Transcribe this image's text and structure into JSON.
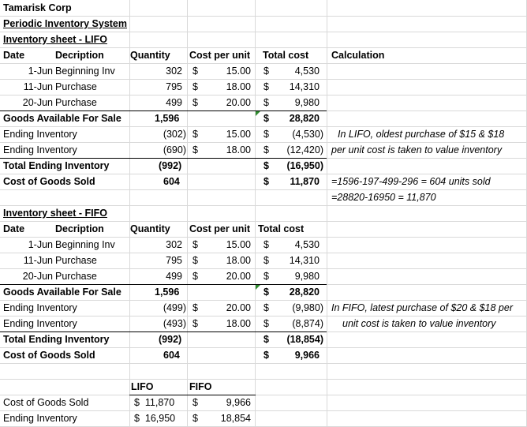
{
  "lifo": {
    "company": "Tamarisk Corp",
    "system": "Periodic Inventory System",
    "sheet_title": "Inventory sheet - LIFO",
    "headers": {
      "date": "Date",
      "desc": "Decription",
      "qty": "Quantity",
      "cpu": "Cost per unit",
      "total": "Total cost",
      "calc": "Calculation"
    },
    "rows": [
      {
        "date": "1-Jun",
        "desc": "Beginning Inv",
        "qty": "302",
        "cur1": "$",
        "cpu": "15.00",
        "cur2": "$",
        "total": "4,530"
      },
      {
        "date": "11-Jun",
        "desc": "Purchase",
        "qty": "795",
        "cur1": "$",
        "cpu": "18.00",
        "cur2": "$",
        "total": "14,310"
      },
      {
        "date": "20-Jun",
        "desc": "Purchase",
        "qty": "499",
        "cur1": "$",
        "cpu": "20.00",
        "cur2": "$",
        "total": "9,980"
      }
    ],
    "goods_available": {
      "label": "Goods Available For Sale",
      "qty": "1,596",
      "cur": "$",
      "total": "28,820"
    },
    "ending_rows": [
      {
        "label": "Ending Inventory",
        "qty": "(302)",
        "cur1": "$",
        "cpu": "15.00",
        "cur2": "$",
        "total": "(4,530)"
      },
      {
        "label": "Ending Inventory",
        "qty": "(690)",
        "cur1": "$",
        "cpu": "18.00",
        "cur2": "$",
        "total": "(12,420)"
      }
    ],
    "total_ending": {
      "label": "Total Ending Inventory",
      "qty": "(992)",
      "cur": "$",
      "total": "(16,950)"
    },
    "cogs": {
      "label": "Cost of Goods Sold",
      "qty": "604",
      "cur": "$",
      "total": "11,870"
    },
    "note_line1": "In LIFO, oldest purchase of $15 & $18",
    "note_line2": "per unit cost is taken to value inventory",
    "calc_line1": "=1596-197-499-296 = 604 units sold",
    "calc_line2": "=28820-16950 = 11,870"
  },
  "fifo": {
    "sheet_title": "Inventory sheet - FIFO",
    "headers": {
      "date": "Date",
      "desc": "Decription",
      "qty": "Quantity",
      "cpu": "Cost per unit",
      "total": "Total cost"
    },
    "rows": [
      {
        "date": "1-Jun",
        "desc": "Beginning Inv",
        "qty": "302",
        "cur1": "$",
        "cpu": "15.00",
        "cur2": "$",
        "total": "4,530"
      },
      {
        "date": "11-Jun",
        "desc": "Purchase",
        "qty": "795",
        "cur1": "$",
        "cpu": "18.00",
        "cur2": "$",
        "total": "14,310"
      },
      {
        "date": "20-Jun",
        "desc": "Purchase",
        "qty": "499",
        "cur1": "$",
        "cpu": "20.00",
        "cur2": "$",
        "total": "9,980"
      }
    ],
    "goods_available": {
      "label": "Goods Available For Sale",
      "qty": "1,596",
      "cur": "$",
      "total": "28,820"
    },
    "ending_rows": [
      {
        "label": "Ending Inventory",
        "qty": "(499)",
        "cur1": "$",
        "cpu": "20.00",
        "cur2": "$",
        "total": "(9,980)"
      },
      {
        "label": "Ending Inventory",
        "qty": "(493)",
        "cur1": "$",
        "cpu": "18.00",
        "cur2": "$",
        "total": "(8,874)"
      }
    ],
    "total_ending": {
      "label": "Total Ending Inventory",
      "qty": "(992)",
      "cur": "$",
      "total": "(18,854)"
    },
    "cogs": {
      "label": "Cost of Goods Sold",
      "qty": "604",
      "cur": "$",
      "total": "9,966"
    },
    "note_line1": "In FIFO, latest purchase of $20 & $18 per",
    "note_line2": "unit cost is taken to value inventory"
  },
  "summary": {
    "col_lifo": "LIFO",
    "col_fifo": "FIFO",
    "rows": [
      {
        "label": "Cost of Goods Sold",
        "lifo": "$  11,870",
        "cur": "$",
        "fifo": "9,966"
      },
      {
        "label": "Ending Inventory",
        "lifo": "$  16,950",
        "cur": "$",
        "fifo": "18,854"
      }
    ]
  }
}
